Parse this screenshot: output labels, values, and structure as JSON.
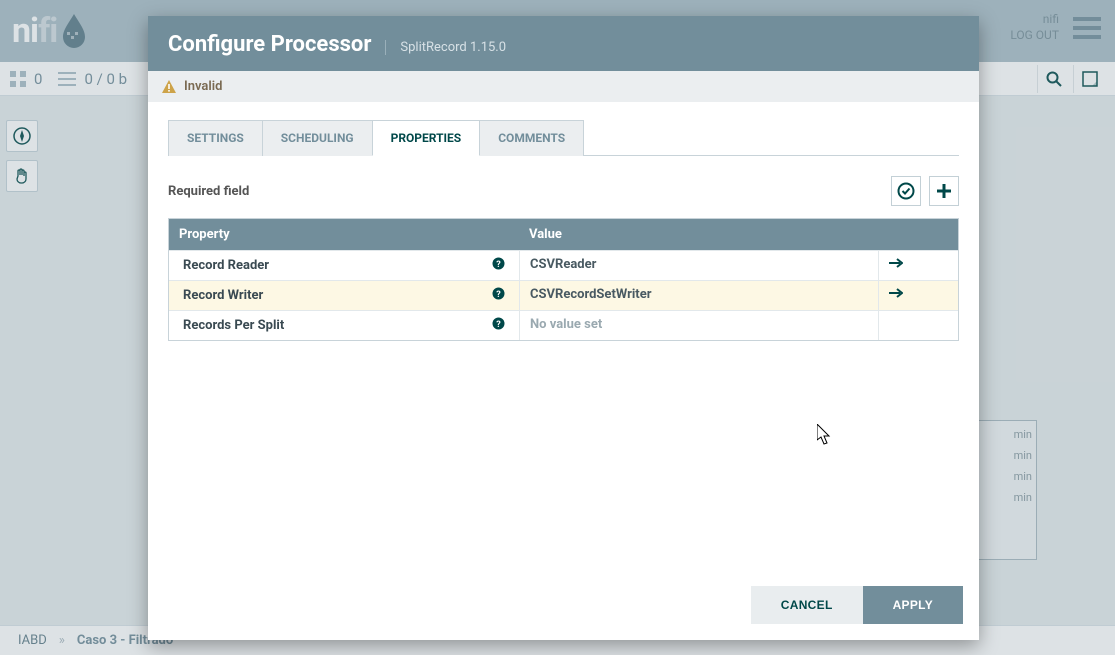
{
  "header": {
    "logo_part1": "ni",
    "logo_part2": "fi",
    "user_name": "nifi",
    "logout_label": "LOG OUT"
  },
  "status_bar": {
    "pg_count": "0",
    "queue_label": "0 / 0 b"
  },
  "breadcrumb": {
    "root": "IABD",
    "current": "Caso 3 - Filtrado"
  },
  "canvas_box_labels": [
    "min",
    "min",
    "min",
    "min"
  ],
  "dialog": {
    "title": "Configure Processor",
    "subtitle": "SplitRecord 1.15.0",
    "warning": "Invalid",
    "tabs": {
      "settings": "SETTINGS",
      "scheduling": "SCHEDULING",
      "properties": "PROPERTIES",
      "comments": "COMMENTS"
    },
    "required_label": "Required field",
    "columns": {
      "name": "Property",
      "value": "Value"
    },
    "props": [
      {
        "name": "Record Reader",
        "value": "CSVReader",
        "has_goto": true,
        "empty": false
      },
      {
        "name": "Record Writer",
        "value": "CSVRecordSetWriter",
        "has_goto": true,
        "empty": false
      },
      {
        "name": "Records Per Split",
        "value": "No value set",
        "has_goto": false,
        "empty": true
      }
    ],
    "buttons": {
      "cancel": "CANCEL",
      "apply": "APPLY"
    }
  }
}
